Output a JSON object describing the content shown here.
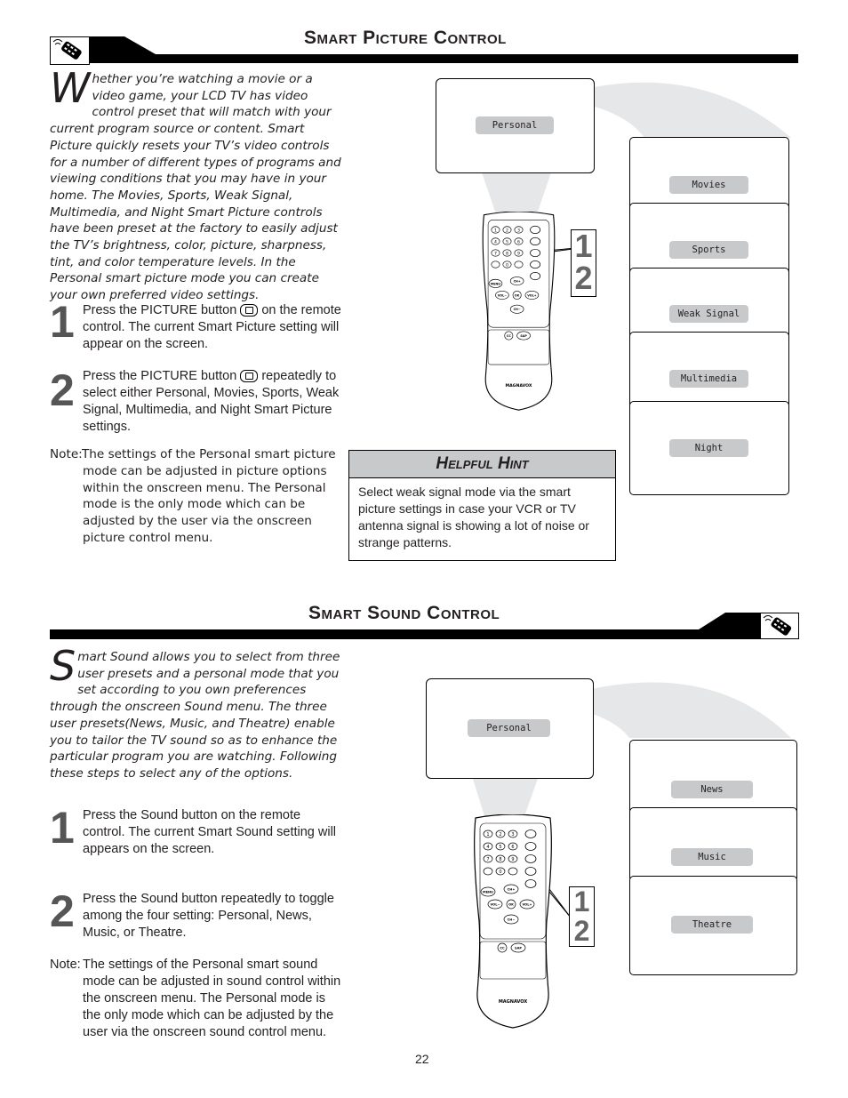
{
  "picture": {
    "title": "Smart Picture Control",
    "dropcap": "W",
    "intro": "hether you’re watching a movie or a video game, your LCD TV has video control preset that will match with your current program source or content. Smart Picture quickly resets your TV’s video controls for a number of different types of programs and viewing conditions that you may have in your home. The Movies, Sports, Weak Signal, Multimedia, and Night Smart Picture controls have been preset at the factory to easily adjust the TV’s brightness, color, picture, sharpness, tint, and color temperature levels. In the Personal smart picture mode you can create your own preferred video settings.",
    "steps": [
      {
        "num": "1",
        "before": "Press the PICTURE button",
        "after": "on the remote control. The current Smart Picture setting will appear on the screen."
      },
      {
        "num": "2",
        "before": "Press the PICTURE button",
        "after": "repeatedly to select either Personal, Movies, Sports, Weak Signal, Multimedia, and Night Smart Picture settings."
      }
    ],
    "note_label": "Note:",
    "note": "The settings of the Personal smart picture mode can be adjusted in picture options within the onscreen menu. The Personal mode is the only mode which can be adjusted by the user via the onscreen picture control menu.",
    "hint_title": "Helpful Hint",
    "hint": "Select weak signal mode via the smart picture settings in case your VCR or TV antenna signal is showing a lot of noise or strange patterns.",
    "screen_label": "Personal",
    "modes": [
      "Movies",
      "Sports",
      "Weak Signal",
      "Multimedia",
      "Night"
    ],
    "callout": [
      "1",
      "2"
    ]
  },
  "sound": {
    "title": "Smart Sound Control",
    "dropcap": "S",
    "intro": "mart Sound allows you to select from three user presets and a personal mode that you set according to you own preferences through the onscreen Sound menu. The three user presets(News, Music, and Theatre) enable you to tailor the TV sound so as to enhance the particular program you are watching. Following these steps to select any of the options.",
    "steps": [
      {
        "num": "1",
        "text": "Press the Sound button on the remote control. The current Smart Sound setting will appears on the screen."
      },
      {
        "num": "2",
        "text": "Press the Sound button repeatedly to toggle among the four setting: Personal, News, Music, or Theatre."
      }
    ],
    "note_label": "Note:",
    "note": "The settings of the Personal smart sound mode can be adjusted in sound control within the onscreen menu. The Personal  mode is the only mode which can be adjusted by the user via the onscreen sound control menu.",
    "screen_label": "Personal",
    "modes": [
      "News",
      "Music",
      "Theatre"
    ],
    "callout": [
      "1",
      "2"
    ]
  },
  "remote": {
    "brand": "MAGNAVOX",
    "numbers": [
      "1",
      "2",
      "3",
      "4",
      "5",
      "6",
      "7",
      "8",
      "9",
      "0"
    ],
    "keys": [
      "CH+",
      "CH−",
      "VOL−",
      "VOL+",
      "OK",
      "MENU",
      "CC",
      "SAP"
    ]
  },
  "page_number": "22",
  "colors": {
    "bar": "#000000",
    "pill": "#c8c9cb",
    "hint_header": "#c8c9cb",
    "swoosh": "#e6e7e8"
  }
}
